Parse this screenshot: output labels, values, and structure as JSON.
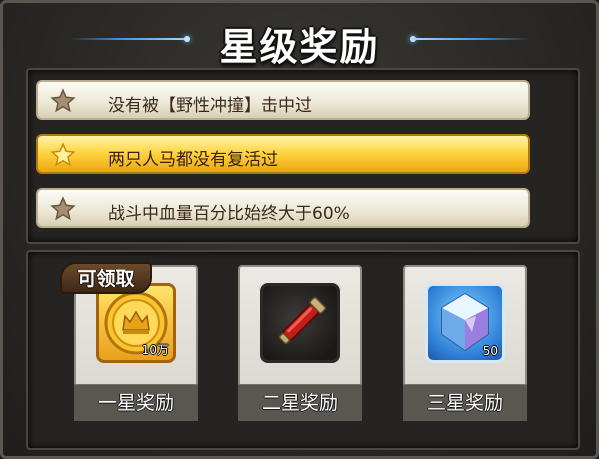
{
  "title": "星级奖励",
  "conditions": [
    {
      "label": "没有被【野性冲撞】击中过",
      "achieved": false
    },
    {
      "label": "两只人马都没有复活过",
      "achieved": true
    },
    {
      "label": "战斗中血量百分比始终大于60%",
      "achieved": false
    }
  ],
  "rewards": [
    {
      "caption": "一星奖励",
      "item_icon": "gold-coin-icon",
      "count": "10万",
      "claimable_badge": "可领取"
    },
    {
      "caption": "二星奖励",
      "item_icon": "red-potion-vial-icon",
      "count": ""
    },
    {
      "caption": "三星奖励",
      "item_icon": "blue-diamond-icon",
      "count": "50"
    }
  ],
  "colors": {
    "accent_gold": "#ffd23c",
    "title_line_blue": "#3d8fd8",
    "panel_bg": "#2a2926"
  }
}
